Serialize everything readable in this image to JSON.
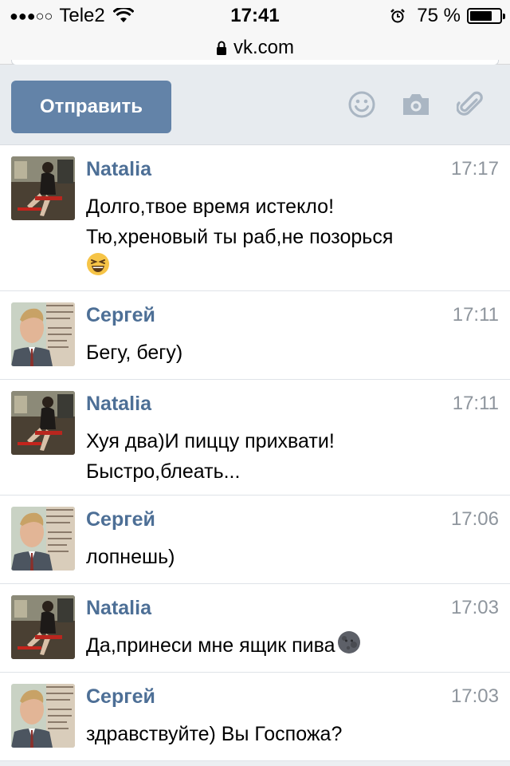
{
  "status_bar": {
    "signal": "●●●○○",
    "carrier": "Tele2",
    "time": "17:41",
    "battery_percent": "75 %",
    "battery_level": 0.75
  },
  "browser": {
    "url": "vk.com"
  },
  "composer": {
    "send_label": "Отправить",
    "icons": [
      "smiley-icon",
      "camera-icon",
      "paperclip-icon"
    ]
  },
  "colors": {
    "accent": "#6383a8",
    "name": "#4d6f96",
    "time": "#8e959d"
  },
  "messages": [
    {
      "author": "Natalia",
      "time": "17:17",
      "lines": [
        "Долго,твое время истекло!",
        "Тю,хреновый ты раб,не позорься"
      ],
      "emoji": "grinning-squint-emoji"
    },
    {
      "author": "Сергей",
      "time": "17:11",
      "lines": [
        "Бегу, бегу)"
      ]
    },
    {
      "author": "Natalia",
      "time": "17:11",
      "lines": [
        "Хуя два)И пиццу прихвати!",
        "Быстро,блеать..."
      ]
    },
    {
      "author": "Сергей",
      "time": "17:06",
      "lines": [
        "лопнешь)"
      ]
    },
    {
      "author": "Natalia",
      "time": "17:03",
      "lines": [
        "Да,принеси мне ящик пива"
      ],
      "emoji": "new-moon-face-emoji"
    },
    {
      "author": "Сергей",
      "time": "17:03",
      "lines": [
        "здравствуйте) Вы Госпожа?"
      ]
    }
  ]
}
